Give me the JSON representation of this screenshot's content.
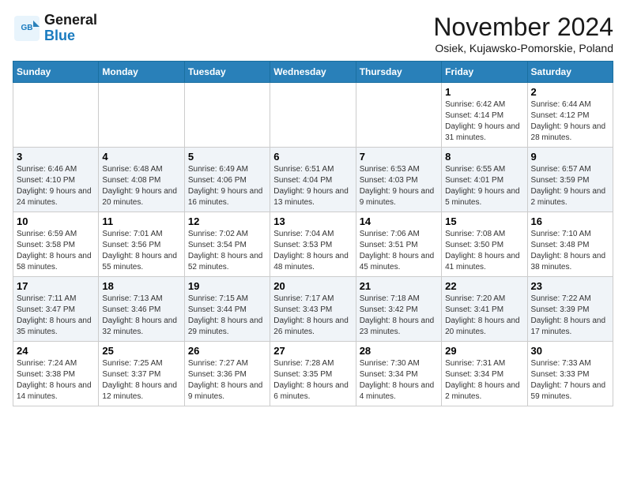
{
  "header": {
    "logo_line1": "General",
    "logo_line2": "Blue",
    "month": "November 2024",
    "location": "Osiek, Kujawsko-Pomorskie, Poland"
  },
  "weekdays": [
    "Sunday",
    "Monday",
    "Tuesday",
    "Wednesday",
    "Thursday",
    "Friday",
    "Saturday"
  ],
  "weeks": [
    [
      {
        "day": "",
        "detail": ""
      },
      {
        "day": "",
        "detail": ""
      },
      {
        "day": "",
        "detail": ""
      },
      {
        "day": "",
        "detail": ""
      },
      {
        "day": "",
        "detail": ""
      },
      {
        "day": "1",
        "detail": "Sunrise: 6:42 AM\nSunset: 4:14 PM\nDaylight: 9 hours and 31 minutes."
      },
      {
        "day": "2",
        "detail": "Sunrise: 6:44 AM\nSunset: 4:12 PM\nDaylight: 9 hours and 28 minutes."
      }
    ],
    [
      {
        "day": "3",
        "detail": "Sunrise: 6:46 AM\nSunset: 4:10 PM\nDaylight: 9 hours and 24 minutes."
      },
      {
        "day": "4",
        "detail": "Sunrise: 6:48 AM\nSunset: 4:08 PM\nDaylight: 9 hours and 20 minutes."
      },
      {
        "day": "5",
        "detail": "Sunrise: 6:49 AM\nSunset: 4:06 PM\nDaylight: 9 hours and 16 minutes."
      },
      {
        "day": "6",
        "detail": "Sunrise: 6:51 AM\nSunset: 4:04 PM\nDaylight: 9 hours and 13 minutes."
      },
      {
        "day": "7",
        "detail": "Sunrise: 6:53 AM\nSunset: 4:03 PM\nDaylight: 9 hours and 9 minutes."
      },
      {
        "day": "8",
        "detail": "Sunrise: 6:55 AM\nSunset: 4:01 PM\nDaylight: 9 hours and 5 minutes."
      },
      {
        "day": "9",
        "detail": "Sunrise: 6:57 AM\nSunset: 3:59 PM\nDaylight: 9 hours and 2 minutes."
      }
    ],
    [
      {
        "day": "10",
        "detail": "Sunrise: 6:59 AM\nSunset: 3:58 PM\nDaylight: 8 hours and 58 minutes."
      },
      {
        "day": "11",
        "detail": "Sunrise: 7:01 AM\nSunset: 3:56 PM\nDaylight: 8 hours and 55 minutes."
      },
      {
        "day": "12",
        "detail": "Sunrise: 7:02 AM\nSunset: 3:54 PM\nDaylight: 8 hours and 52 minutes."
      },
      {
        "day": "13",
        "detail": "Sunrise: 7:04 AM\nSunset: 3:53 PM\nDaylight: 8 hours and 48 minutes."
      },
      {
        "day": "14",
        "detail": "Sunrise: 7:06 AM\nSunset: 3:51 PM\nDaylight: 8 hours and 45 minutes."
      },
      {
        "day": "15",
        "detail": "Sunrise: 7:08 AM\nSunset: 3:50 PM\nDaylight: 8 hours and 41 minutes."
      },
      {
        "day": "16",
        "detail": "Sunrise: 7:10 AM\nSunset: 3:48 PM\nDaylight: 8 hours and 38 minutes."
      }
    ],
    [
      {
        "day": "17",
        "detail": "Sunrise: 7:11 AM\nSunset: 3:47 PM\nDaylight: 8 hours and 35 minutes."
      },
      {
        "day": "18",
        "detail": "Sunrise: 7:13 AM\nSunset: 3:46 PM\nDaylight: 8 hours and 32 minutes."
      },
      {
        "day": "19",
        "detail": "Sunrise: 7:15 AM\nSunset: 3:44 PM\nDaylight: 8 hours and 29 minutes."
      },
      {
        "day": "20",
        "detail": "Sunrise: 7:17 AM\nSunset: 3:43 PM\nDaylight: 8 hours and 26 minutes."
      },
      {
        "day": "21",
        "detail": "Sunrise: 7:18 AM\nSunset: 3:42 PM\nDaylight: 8 hours and 23 minutes."
      },
      {
        "day": "22",
        "detail": "Sunrise: 7:20 AM\nSunset: 3:41 PM\nDaylight: 8 hours and 20 minutes."
      },
      {
        "day": "23",
        "detail": "Sunrise: 7:22 AM\nSunset: 3:39 PM\nDaylight: 8 hours and 17 minutes."
      }
    ],
    [
      {
        "day": "24",
        "detail": "Sunrise: 7:24 AM\nSunset: 3:38 PM\nDaylight: 8 hours and 14 minutes."
      },
      {
        "day": "25",
        "detail": "Sunrise: 7:25 AM\nSunset: 3:37 PM\nDaylight: 8 hours and 12 minutes."
      },
      {
        "day": "26",
        "detail": "Sunrise: 7:27 AM\nSunset: 3:36 PM\nDaylight: 8 hours and 9 minutes."
      },
      {
        "day": "27",
        "detail": "Sunrise: 7:28 AM\nSunset: 3:35 PM\nDaylight: 8 hours and 6 minutes."
      },
      {
        "day": "28",
        "detail": "Sunrise: 7:30 AM\nSunset: 3:34 PM\nDaylight: 8 hours and 4 minutes."
      },
      {
        "day": "29",
        "detail": "Sunrise: 7:31 AM\nSunset: 3:34 PM\nDaylight: 8 hours and 2 minutes."
      },
      {
        "day": "30",
        "detail": "Sunrise: 7:33 AM\nSunset: 3:33 PM\nDaylight: 7 hours and 59 minutes."
      }
    ]
  ]
}
